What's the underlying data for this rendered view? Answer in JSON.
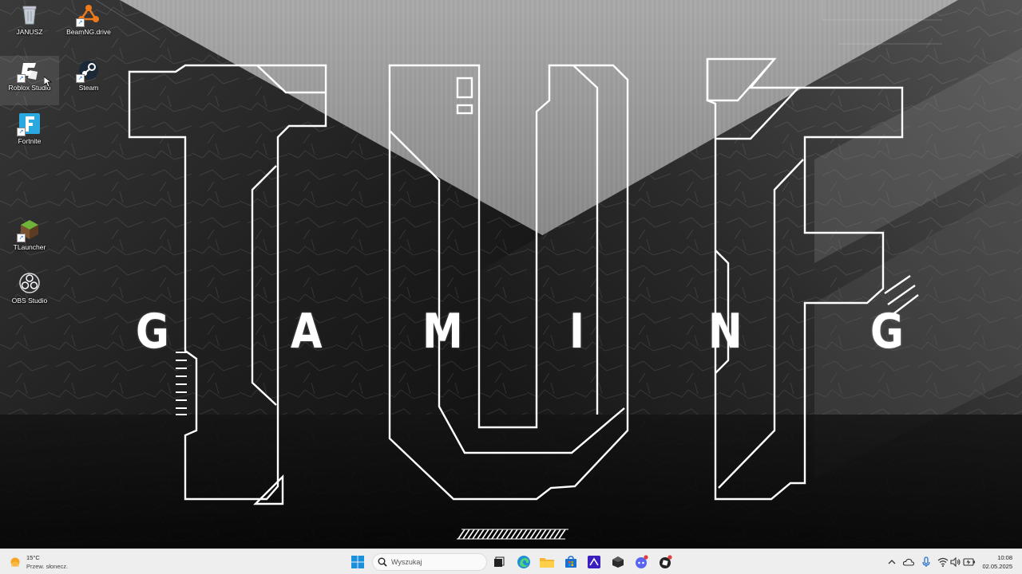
{
  "desktop": {
    "icons": [
      {
        "label": "JANUSZ"
      },
      {
        "label": "BeamNG.drive"
      },
      {
        "label": "Roblox Studio"
      },
      {
        "label": "Steam"
      },
      {
        "label": "Fortnite"
      },
      {
        "label": "TLauncher"
      },
      {
        "label": "OBS Studio"
      }
    ]
  },
  "wallpaper": {
    "gaming_letters": [
      "G",
      "A",
      "M",
      "I",
      "N",
      "G"
    ]
  },
  "taskbar": {
    "weather": {
      "temperature": "15°C",
      "condition": "Przew. słonecz."
    },
    "search": {
      "placeholder": "Wyszukaj"
    },
    "clock": {
      "time": "10:08",
      "date": "02.05.2025"
    }
  },
  "colors": {
    "taskbar_bg": "#eeeeee",
    "accent_blue": "#1b6ac9",
    "wallpaper_outline": "#ffffff"
  }
}
